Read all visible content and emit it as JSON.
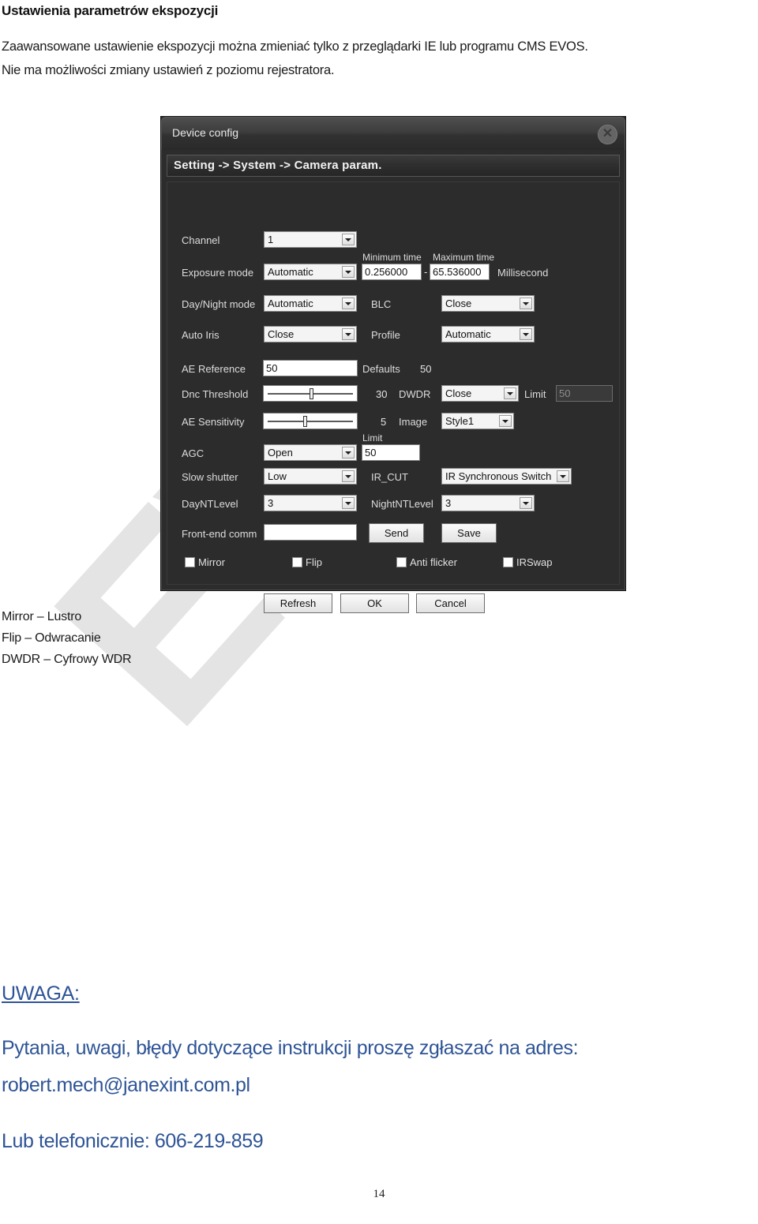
{
  "document": {
    "title": "Ustawienia parametrów ekspozycji",
    "paragraph_line1": "Zaawansowane ustawienie ekspozycji można zmieniać tylko z przeglądarki IE lub programu CMS EVOS.",
    "paragraph_line2": "Nie ma możliwości zmiany ustawień z poziomu rejestratora.",
    "page_number": "14",
    "watermark": "EVOS"
  },
  "legend": {
    "line1": "Mirror –  Lustro",
    "line2": "Flip – Odwracanie",
    "line3": "DWDR – Cyfrowy WDR"
  },
  "note": {
    "heading": "UWAGA:",
    "body": "Pytania, uwagi, błędy dotyczące instrukcji proszę zgłaszać na adres:",
    "email": "robert.mech@janexint.com.pl",
    "phone": "Lub telefonicznie: 606-219-859",
    "color": "#2e5496"
  },
  "dialog": {
    "window_title": "Device config",
    "close_icon": "close-circle-icon",
    "breadcrumb": "Setting -> System -> Camera param.",
    "rows": {
      "channel": {
        "label": "Channel",
        "value": "1"
      },
      "minimum_time": {
        "label": "Minimum time",
        "value": "0.256000"
      },
      "maximum_time": {
        "label": "Maximum time",
        "value": "65.536000"
      },
      "time_separator": "-",
      "millisecond": {
        "label": "Millisecond"
      },
      "exposure_mode": {
        "label": "Exposure mode",
        "value": "Automatic"
      },
      "day_night_mode": {
        "label": "Day/Night mode",
        "value": "Automatic"
      },
      "blc": {
        "label": "BLC",
        "value": "Close"
      },
      "auto_iris": {
        "label": "Auto Iris",
        "value": "Close"
      },
      "profile": {
        "label": "Profile",
        "value": "Automatic"
      },
      "ae_reference": {
        "label": "AE Reference",
        "value": "50"
      },
      "defaults": {
        "label": "Defaults",
        "value": "50"
      },
      "dnc_threshold": {
        "label": "Dnc Threshold",
        "value": "30"
      },
      "dwdr": {
        "label": "DWDR",
        "value": "Close"
      },
      "dwdr_limit": {
        "label": "Limit",
        "value": "50"
      },
      "ae_sensitivity": {
        "label": "AE Sensitivity",
        "value": "5"
      },
      "image": {
        "label": "Image",
        "value": "Style1"
      },
      "agc": {
        "label": "AGC",
        "value": "Open"
      },
      "agc_limit": {
        "label": "Limit",
        "value": "50"
      },
      "slow_shutter": {
        "label": "Slow shutter",
        "value": "Low"
      },
      "ir_cut": {
        "label": "IR_CUT",
        "value": "IR Synchronous Switch"
      },
      "day_nt_level": {
        "label": "DayNTLevel",
        "value": "3"
      },
      "night_nt_level": {
        "label": "NightNTLevel",
        "value": "3"
      },
      "front_end_command": {
        "label": "Front-end comm",
        "value": ""
      }
    },
    "buttons": {
      "send": "Send",
      "save": "Save",
      "refresh": "Refresh",
      "ok": "OK",
      "cancel": "Cancel"
    },
    "checkboxes": [
      {
        "label": "Mirror",
        "checked": false
      },
      {
        "label": "Flip",
        "checked": false
      },
      {
        "label": "Anti flicker",
        "checked": false
      },
      {
        "label": "IRSwap",
        "checked": false
      }
    ]
  }
}
